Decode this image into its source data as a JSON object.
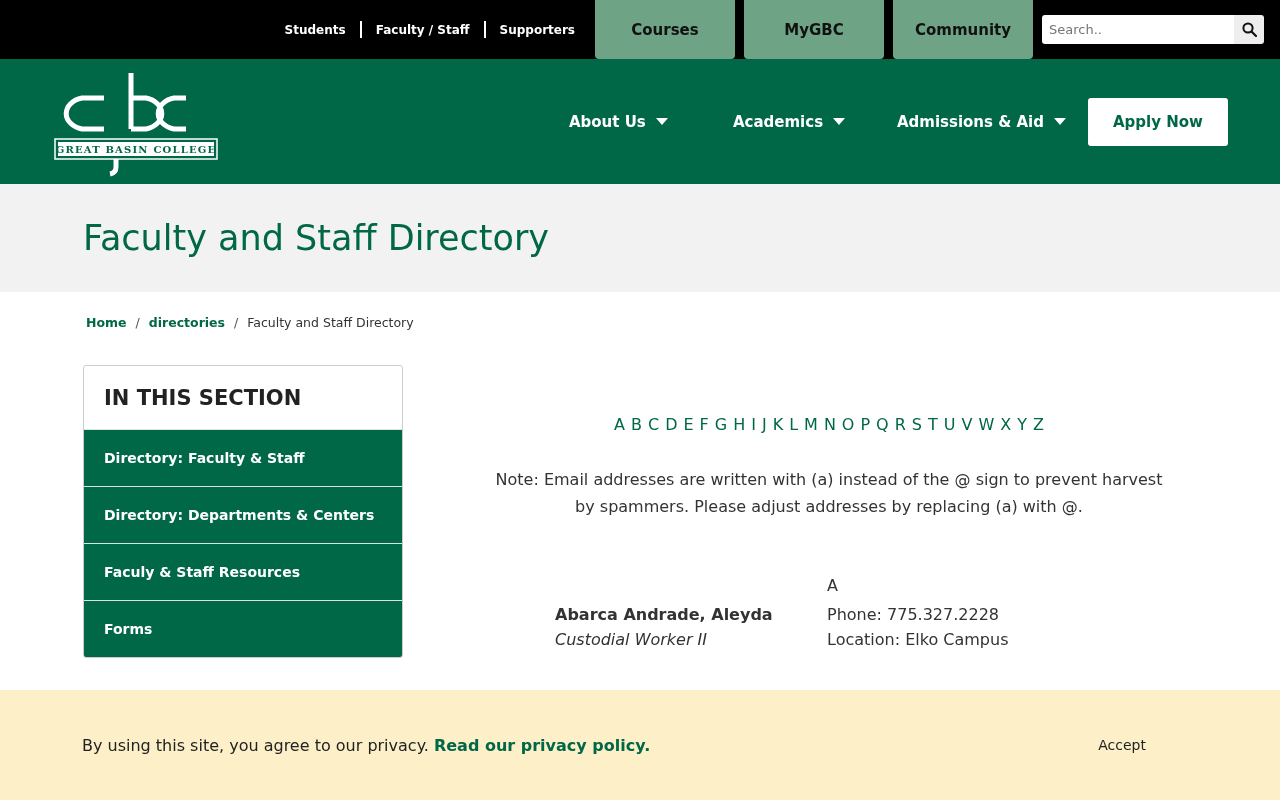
{
  "utility_links": [
    "Students",
    "Faculty / Staff",
    "Supporters"
  ],
  "quick_tabs": [
    "Courses",
    "MyGBC",
    "Community"
  ],
  "search": {
    "placeholder": "Search.."
  },
  "logo": {
    "text": "GREAT BASIN COLLEGE"
  },
  "main_nav": [
    "About Us",
    "Academics",
    "Admissions & Aid"
  ],
  "apply_button": "Apply Now",
  "page_title": "Faculty and Staff Directory",
  "breadcrumb": {
    "separator": "/",
    "items": [
      {
        "label": "Home",
        "link": true
      },
      {
        "label": "directories",
        "link": true
      },
      {
        "label": "Faculty and Staff Directory",
        "link": false
      }
    ]
  },
  "sidebar": {
    "title": "IN THIS SECTION",
    "items": [
      "Directory: Faculty & Staff",
      "Directory: Departments & Centers",
      "Faculy & Staff Resources",
      "Forms"
    ]
  },
  "alphabet": [
    "A",
    "B",
    "C",
    "D",
    "E",
    "F",
    "G",
    "H",
    "I",
    "J",
    "K",
    "L",
    "M",
    "N",
    "O",
    "P",
    "Q",
    "R",
    "S",
    "T",
    "U",
    "V",
    "W",
    "X",
    "Y",
    "Z"
  ],
  "note": "Note: Email addresses are written with (a) instead of the @ sign to prevent harvest by spammers. Please adjust addresses by replacing (a) with @.",
  "directory": [
    {
      "letter": "A",
      "entries": [
        {
          "name": "Abarca Andrade, Aleyda",
          "title": "Custodial Worker II",
          "phone": "Phone: 775.327.2228",
          "location": "Location: Elko Campus"
        }
      ]
    }
  ],
  "cookie_banner": {
    "text": "By using this site, you agree to our privacy.",
    "link": "Read our privacy policy.",
    "button": "Accept"
  }
}
